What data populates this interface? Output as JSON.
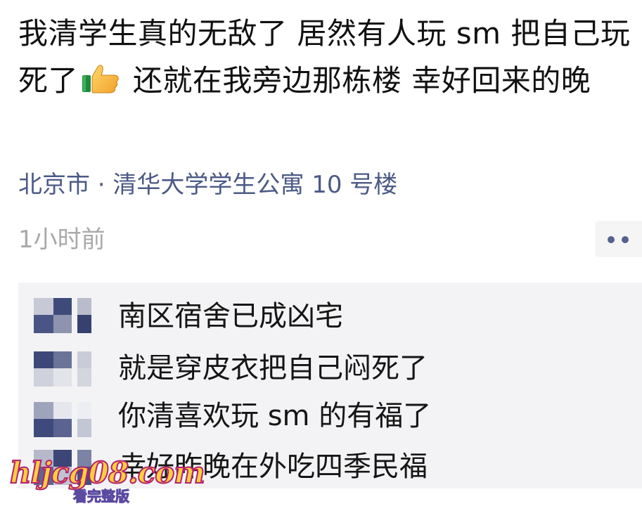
{
  "post": {
    "text_before_emoji": "我清学生真的无敌了 居然有人玩 sm 把自己玩死了",
    "emoji": "thumbs-up-icon",
    "text_after_emoji": " 还就在我旁边那栋楼 幸好回来的晚",
    "location": "北京市 · 清华大学学生公寓 10 号楼",
    "time": "1小时前"
  },
  "more_button": {
    "icon": "more-dots-icon",
    "accent": "#54628f"
  },
  "comments": [
    {
      "text": "南区宿舍已成凶宅"
    },
    {
      "text": "就是穿皮衣把自己闷死了"
    },
    {
      "text": "你清喜欢玩 sm 的有福了"
    },
    {
      "text": "幸好昨晚在外吃四季民福"
    }
  ],
  "watermark": {
    "main": "hljcg08.com",
    "sub": "看完整版"
  },
  "colors": {
    "location": "#4b5a86",
    "time": "#a9a9a9",
    "comments_bg": "#f3f3f5"
  }
}
